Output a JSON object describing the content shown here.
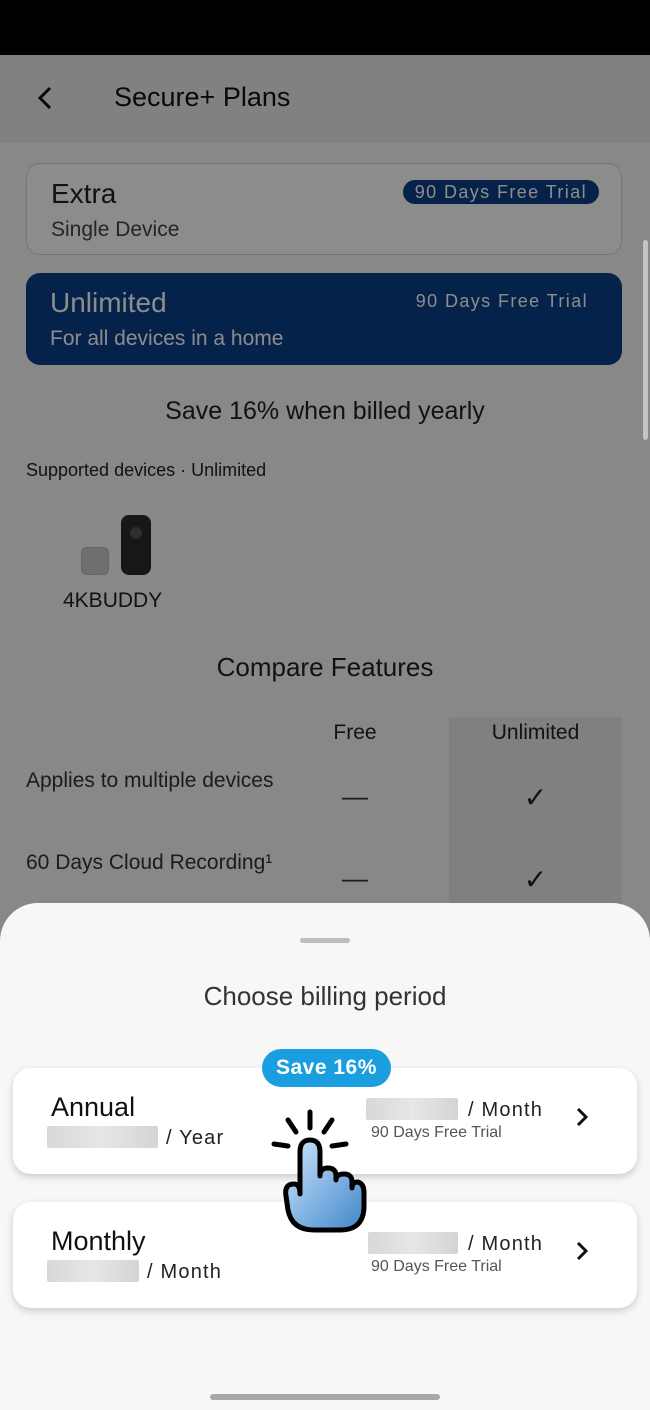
{
  "appbar": {
    "title": "Secure+ Plans",
    "back_icon": "back-arrow-icon"
  },
  "plans": [
    {
      "name": "Extra",
      "subtitle": "Single Device",
      "trial": "90 Days Free Trial"
    },
    {
      "name": "Unlimited",
      "subtitle": "For all devices in a home",
      "trial": "90 Days Free Trial",
      "selected": true
    }
  ],
  "save_line": "Save 16% when billed yearly",
  "supported": {
    "label": "Supported devices · Unlimited",
    "device_name": "4KBUDDY"
  },
  "compare": {
    "title": "Compare Features",
    "columns": [
      "Free",
      "Unlimited"
    ],
    "rows": [
      {
        "feature": "Applies to multiple devices",
        "free": "—",
        "unlimited": "✓"
      },
      {
        "feature": "60 Days Cloud Recording¹",
        "free": "—",
        "unlimited": "✓"
      }
    ]
  },
  "sheet": {
    "title": "Choose billing period",
    "badge": "Save 16%",
    "options": [
      {
        "name": "Annual",
        "per_left": "/ Year",
        "per_right": "/ Month",
        "trial": "90 Days Free Trial"
      },
      {
        "name": "Monthly",
        "per_left": "/ Month",
        "per_right": "/ Month",
        "trial": "90 Days Free Trial"
      }
    ]
  },
  "colors": {
    "selected_plan": "#0a3f87",
    "badge": "#1a9ee0"
  }
}
